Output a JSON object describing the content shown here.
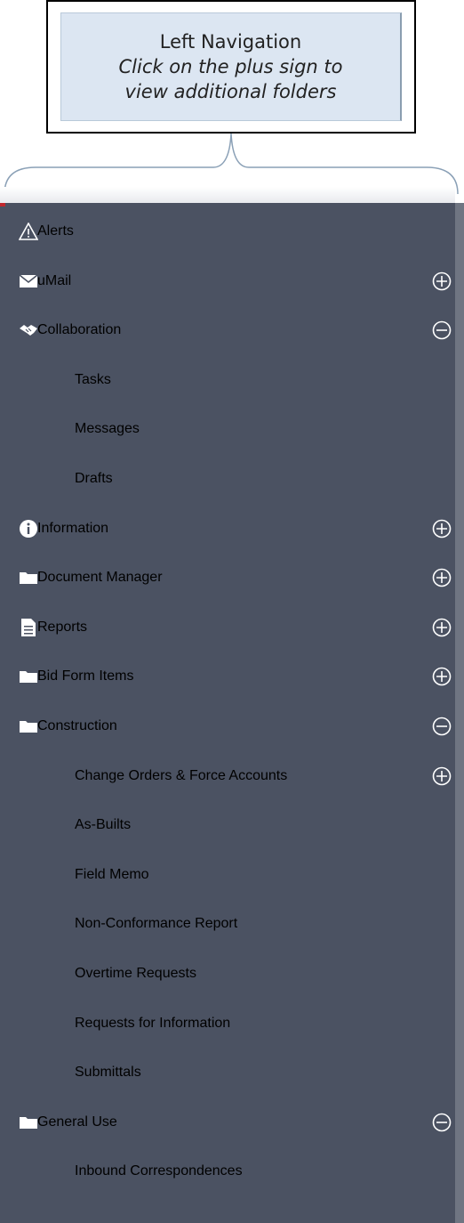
{
  "callout": {
    "line1": "Left Navigation",
    "line2": "Click on the plus sign to",
    "line3": "view additional folders"
  },
  "nav": {
    "items": [
      {
        "label": "Alerts",
        "icon": "warning-icon",
        "level": 0
      },
      {
        "label": "uMail",
        "icon": "envelope-icon",
        "level": 0,
        "toggle": "expand"
      },
      {
        "label": "Collaboration",
        "icon": "handshake-icon",
        "level": 0,
        "toggle": "collapse"
      },
      {
        "label": "Tasks",
        "level": 1
      },
      {
        "label": "Messages",
        "level": 1
      },
      {
        "label": "Drafts",
        "level": 1
      },
      {
        "label": "Information",
        "icon": "info-icon",
        "level": 0,
        "toggle": "expand"
      },
      {
        "label": "Document Manager",
        "icon": "folder-icon",
        "level": 0,
        "toggle": "expand"
      },
      {
        "label": "Reports",
        "icon": "document-icon",
        "level": 0,
        "toggle": "expand"
      },
      {
        "label": "Bid Form Items",
        "icon": "folder-icon",
        "level": 0,
        "toggle": "expand"
      },
      {
        "label": "Construction",
        "icon": "folder-icon",
        "level": 0,
        "toggle": "collapse"
      },
      {
        "label": "Change Orders & Force Accounts",
        "level": 1,
        "toggle": "expand"
      },
      {
        "label": "As-Builts",
        "level": 1
      },
      {
        "label": "Field Memo",
        "level": 1
      },
      {
        "label": "Non-Conformance Report",
        "level": 1
      },
      {
        "label": "Overtime Requests",
        "level": 1
      },
      {
        "label": "Requests for Information",
        "level": 1
      },
      {
        "label": "Submittals",
        "level": 1
      },
      {
        "label": "General Use",
        "icon": "folder-icon",
        "level": 0,
        "toggle": "collapse"
      },
      {
        "label": "Inbound Correspondences",
        "level": 1
      }
    ]
  },
  "colors": {
    "nav_background": "#4b5262",
    "callout_fill": "#dce6f2",
    "nav_text": "#ffffff"
  }
}
